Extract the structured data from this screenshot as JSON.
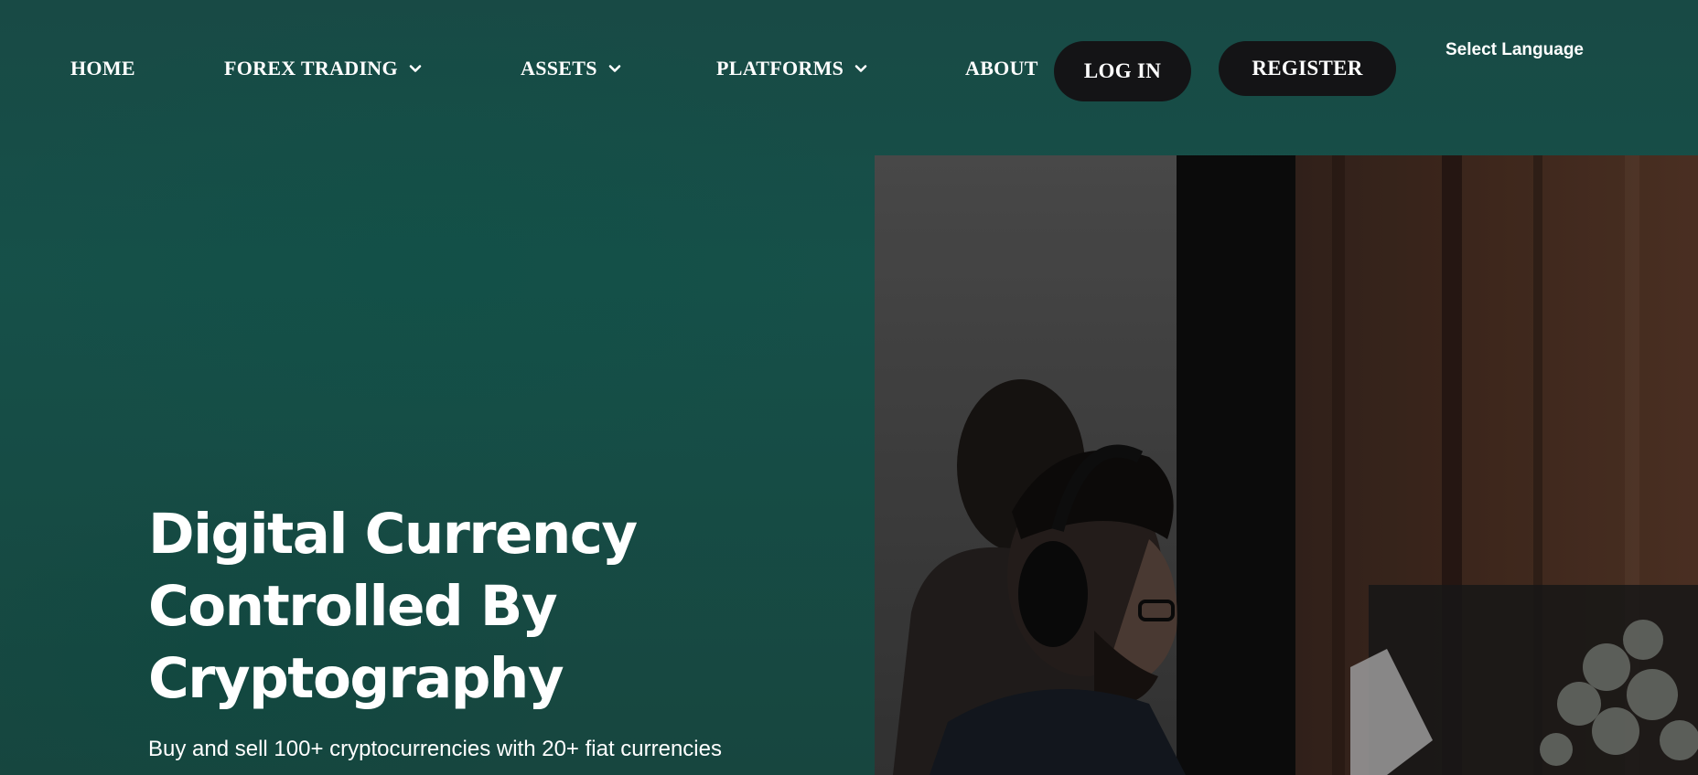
{
  "nav": {
    "items": [
      {
        "label": "HOME",
        "has_dropdown": false
      },
      {
        "label": "FOREX TRADING",
        "has_dropdown": true
      },
      {
        "label": "ASSETS",
        "has_dropdown": true
      },
      {
        "label": "PLATFORMS",
        "has_dropdown": true
      },
      {
        "label": "ABOUT",
        "has_dropdown": false
      }
    ],
    "login_label": "LOG IN",
    "register_label": "REGISTER",
    "language_label": "Select Language"
  },
  "hero": {
    "title_lines": [
      "Digital Currency",
      "Controlled By",
      "Cryptography"
    ],
    "subtitle": "Buy and sell 100+ cryptocurrencies with 20+ fiat currencies"
  },
  "colors": {
    "background": "#17443f",
    "button_bg": "#141416",
    "text": "#ffffff"
  },
  "icons": {
    "dropdown": "chevron-down-icon"
  }
}
